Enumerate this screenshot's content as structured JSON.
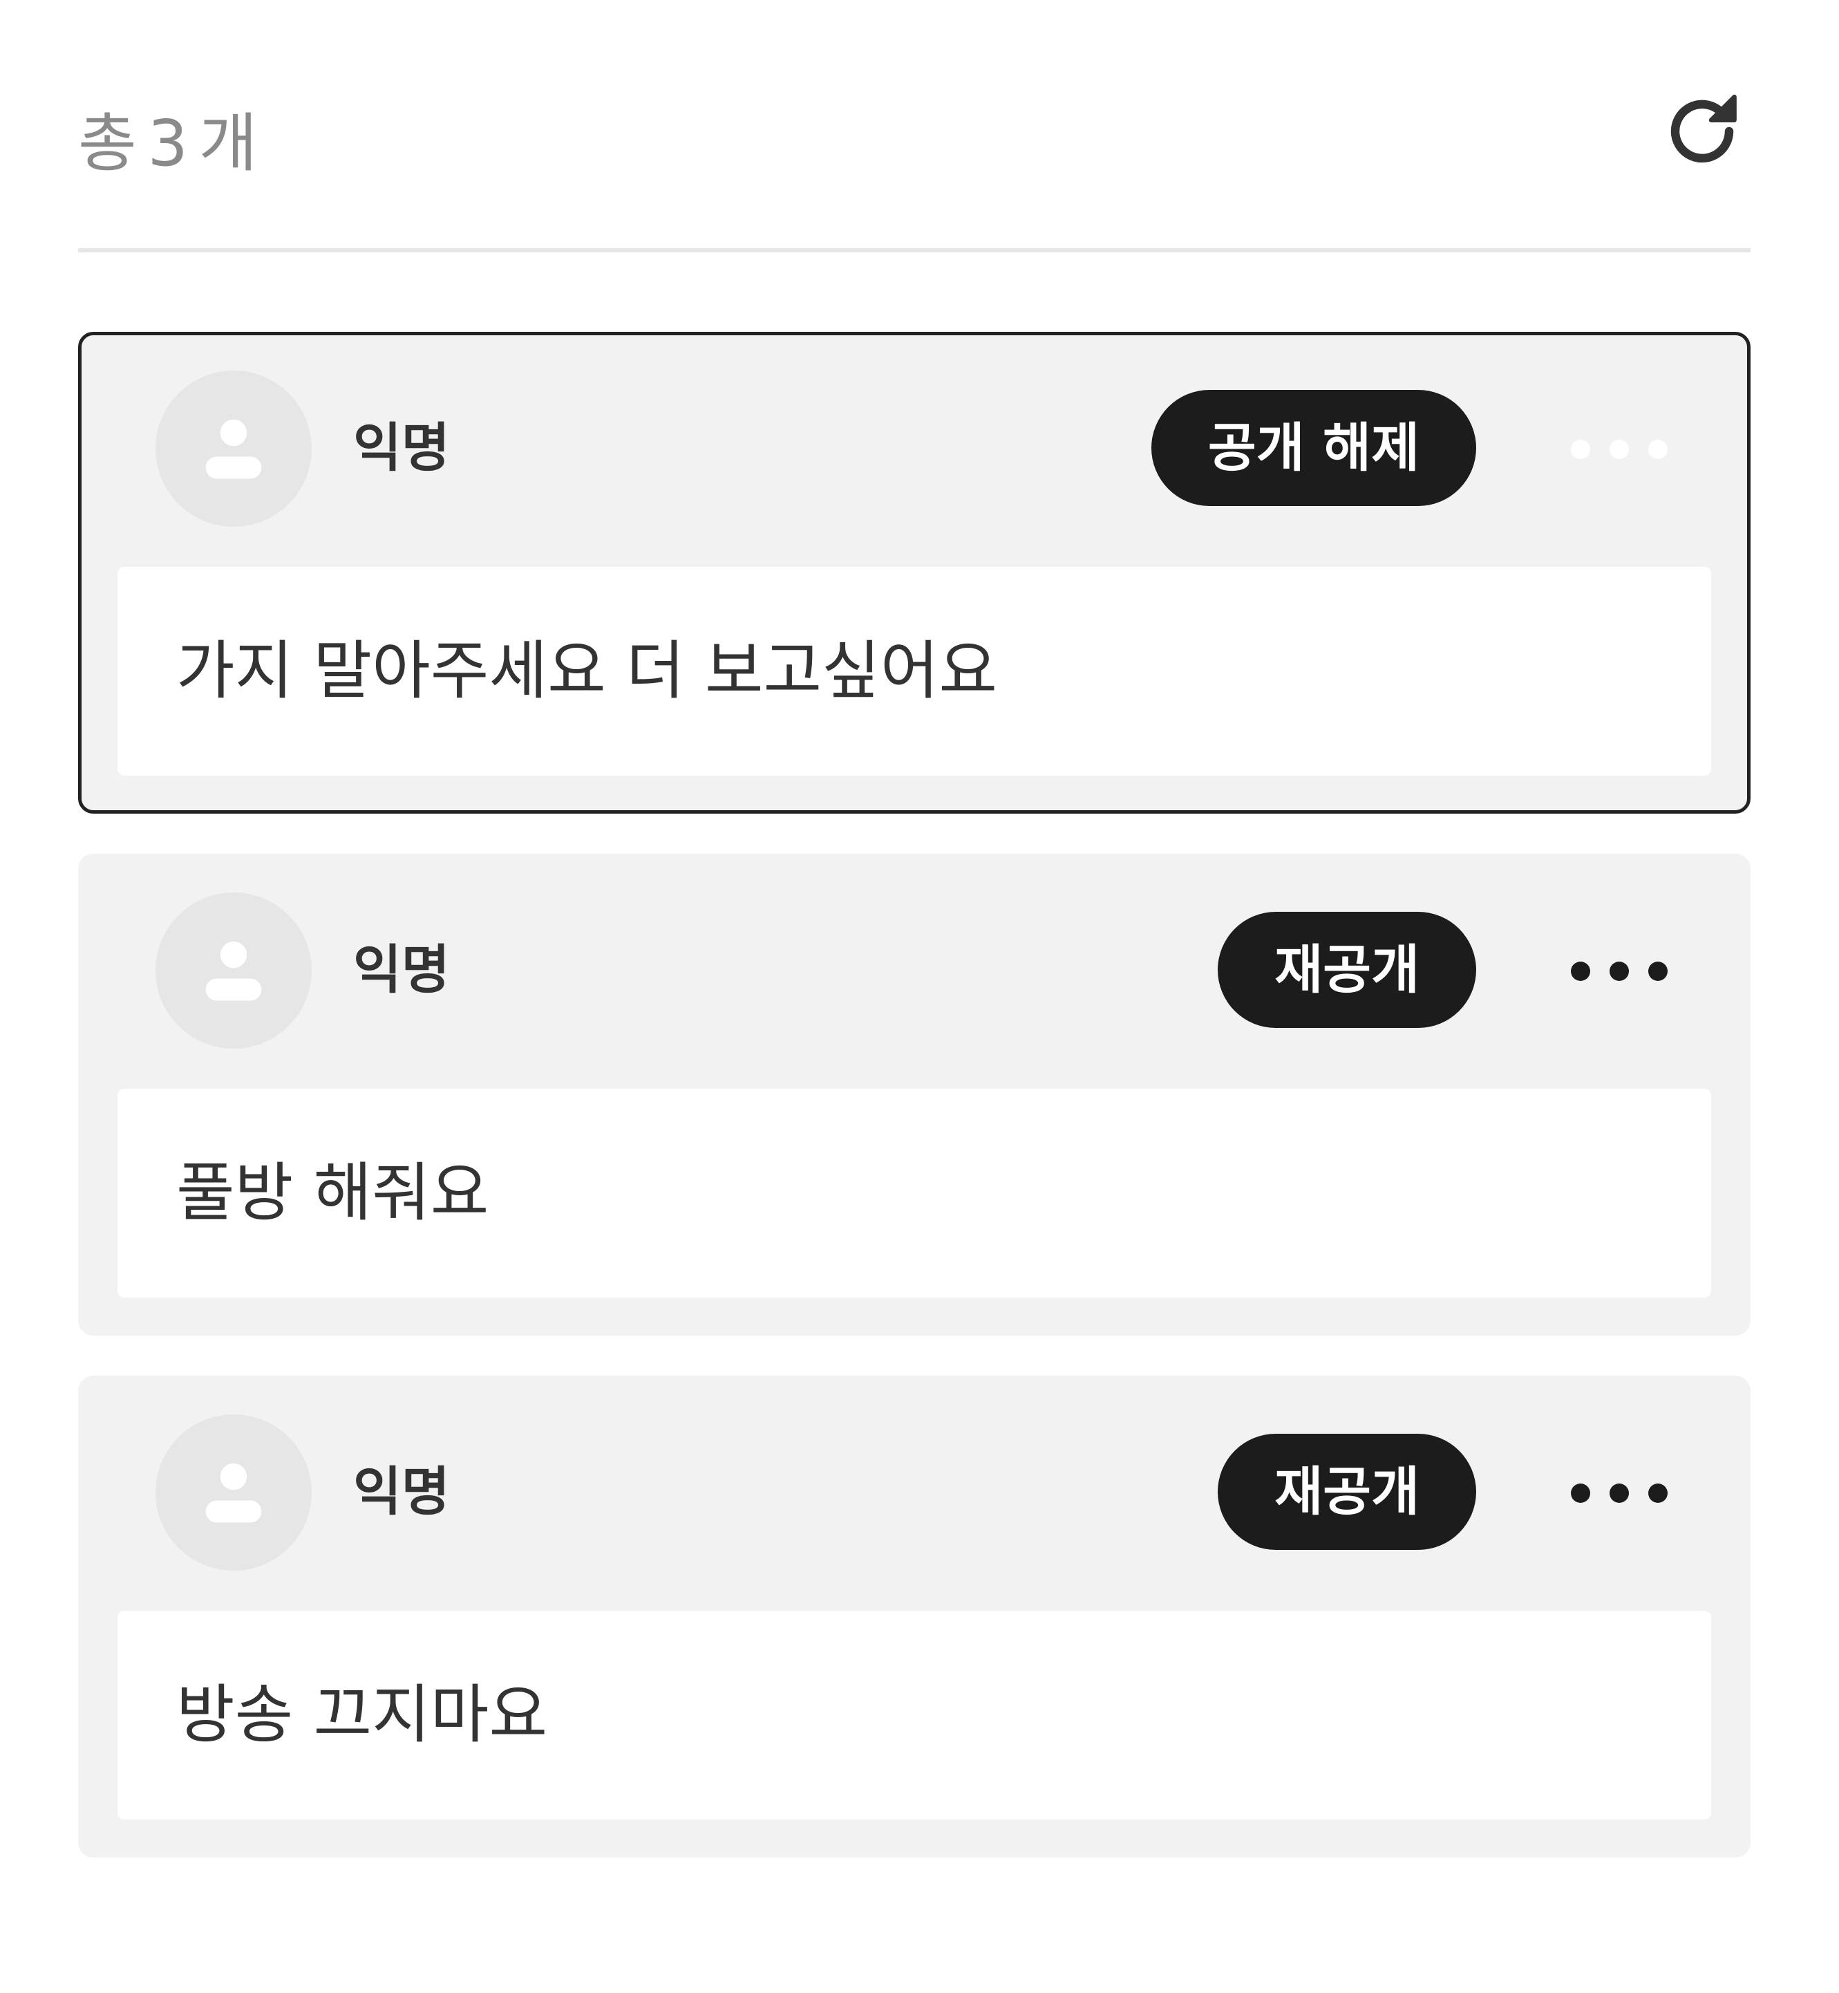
{
  "header": {
    "count_prefix": "총",
    "count_value": "3",
    "count_suffix": "개",
    "refresh_icon": "refresh-icon"
  },
  "comments": [
    {
      "author": "익명",
      "action_label": "공개 해제",
      "message": "가지 말아주세요 더 보고싶어요",
      "selected": true,
      "more_icon": "more-horizontal-icon"
    },
    {
      "author": "익명",
      "action_label": "재공개",
      "message": "풀방 해줘요",
      "selected": false,
      "more_icon": "more-horizontal-icon"
    },
    {
      "author": "익명",
      "action_label": "재공개",
      "message": "방송 끄지마요",
      "selected": false,
      "more_icon": "more-horizontal-icon"
    }
  ],
  "colors": {
    "pill_background": "#1c1c1c",
    "card_background": "#f2f2f2",
    "count_text": "#8a8a8a"
  }
}
